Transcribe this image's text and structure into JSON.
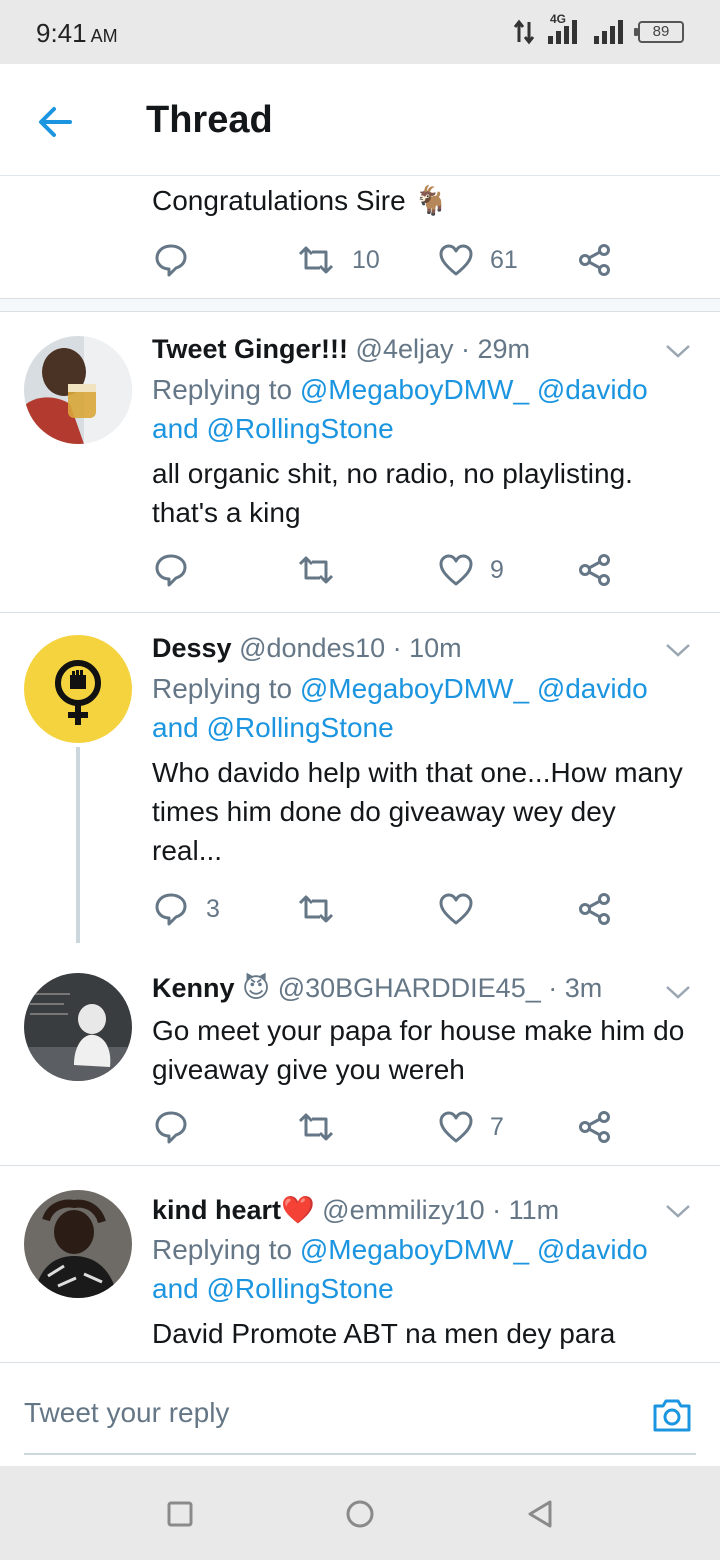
{
  "status_bar": {
    "time": "9:41",
    "ampm": "AM",
    "network": "4G",
    "battery": "89"
  },
  "header": {
    "title": "Thread"
  },
  "top_tweet": {
    "text": "Congratulations Sire 🐐",
    "retweets": "10",
    "likes": "61"
  },
  "tweets": [
    {
      "name": "Tweet Ginger!!!",
      "handle": "@4eljay",
      "time": "· 29m",
      "replying_prefix": "Replying to",
      "mention1": "@MegaboyDMW_",
      "mention2": "@davido",
      "and": "and",
      "mention3": "@RollingStone",
      "text": "all organic shit, no radio, no playlisting. that's a king",
      "replies": "",
      "retweets": "",
      "likes": "9"
    },
    {
      "name": "Dessy",
      "handle": "@dondes10",
      "time": "· 10m",
      "replying_prefix": "Replying to",
      "mention1": "@MegaboyDMW_",
      "mention2": "@davido",
      "and": "and",
      "mention3": "@RollingStone",
      "text": "Who davido help with that one...How many times him done do giveaway wey dey real...",
      "replies": "3",
      "retweets": "",
      "likes": ""
    },
    {
      "name": "Kenny",
      "name_emoji": "😈",
      "handle": "@30BGHARDDIE45_",
      "time": "· 3m",
      "text": "Go meet your papa for house make him do giveaway give you wereh",
      "replies": "",
      "retweets": "",
      "likes": "7"
    },
    {
      "name": "kind heart",
      "name_emoji": "❤️",
      "handle": "@emmilizy10",
      "time": "· 11m",
      "replying_prefix": "Replying to",
      "mention1": "@MegaboyDMW_",
      "mention2": "@davido",
      "and": "and",
      "mention3": "@RollingStone",
      "text": "David  Promote ABT na men dey para"
    }
  ],
  "reply_bar": {
    "placeholder": "Tweet your reply"
  },
  "colors": {
    "accent": "#1b95e0",
    "muted": "#657786",
    "text": "#14171a"
  },
  "icons": {
    "back": "arrow-left-icon",
    "reply": "speech-bubble-icon",
    "retweet": "retweet-icon",
    "like": "heart-icon",
    "share": "share-icon",
    "more": "chevron-down-icon",
    "camera": "camera-icon"
  }
}
